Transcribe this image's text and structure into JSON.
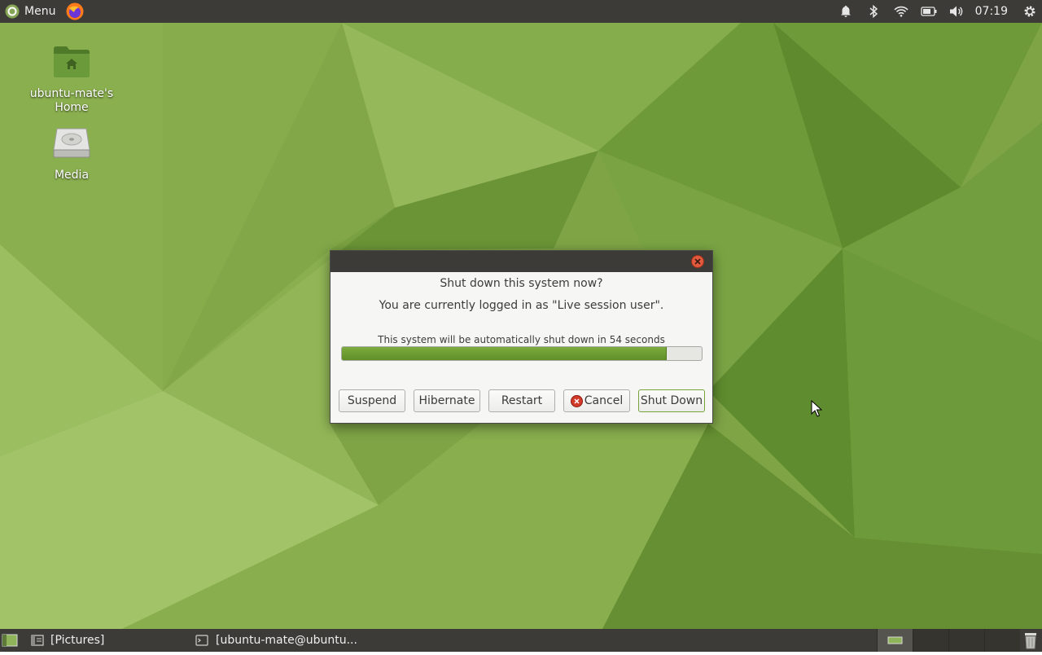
{
  "top_panel": {
    "menu_label": "Menu",
    "clock": "07:19",
    "icons": [
      "ubuntu-mate-logo-icon",
      "firefox-icon",
      "notification-bell-icon",
      "bluetooth-icon",
      "wifi-icon",
      "battery-icon",
      "volume-icon",
      "settings-gear-icon"
    ]
  },
  "desktop": {
    "icons": [
      {
        "label_line1": "ubuntu-mate's",
        "label_line2": "Home",
        "icon": "home-folder-icon"
      },
      {
        "label_line1": "Media",
        "icon": "hard-drive-icon"
      }
    ]
  },
  "dialog": {
    "title": "Shut down this system now?",
    "subtitle": "You are currently logged in as \"Live session user\".",
    "countdown_text": "This system will be automatically shut down in 54 seconds",
    "progress_fraction": 0.9,
    "buttons": {
      "suspend": "Suspend",
      "hibernate": "Hibernate",
      "restart": "Restart",
      "cancel": "Cancel",
      "shutdown": "Shut Down"
    },
    "accent_color": "#6a9a30"
  },
  "bottom_panel": {
    "tasks": [
      {
        "label": "[Pictures]",
        "icon": "file-manager-icon"
      },
      {
        "label": "[ubuntu-mate@ubuntu...",
        "icon": "terminal-icon"
      }
    ],
    "workspace_count": 4,
    "active_workspace": 1
  },
  "colors": {
    "panel": "#3c3b37",
    "wallpaper_base": "#7ea446"
  }
}
